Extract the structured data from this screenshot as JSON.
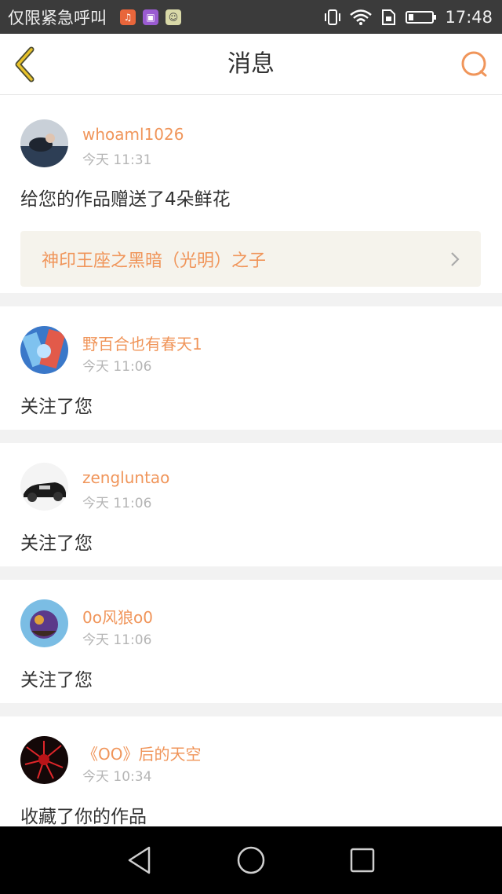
{
  "status_bar": {
    "carrier": "仅限紧急呼叫",
    "time": "17:48",
    "icons": [
      "music-app-icon",
      "gallery-app-icon",
      "chat-app-icon",
      "vibrate-icon",
      "wifi-icon",
      "sim-icon",
      "battery-icon"
    ]
  },
  "header": {
    "title": "消息",
    "accent_color": "#f0955a"
  },
  "messages": [
    {
      "username": "whoaml1026",
      "time": "今天 11:31",
      "action": "给您的作品赠送了4朵鲜花",
      "work_title": "神印王座之黑暗（光明）之子"
    },
    {
      "username": "野百合也有春天1",
      "time": "今天 11:06",
      "action": "关注了您"
    },
    {
      "username": "zengluntao",
      "time": "今天 11:06",
      "action": "关注了您"
    },
    {
      "username": "0o风狼o0",
      "time": "今天 11:06",
      "action": "关注了您"
    },
    {
      "username": "《OO》后的天空",
      "time": "今天 10:34",
      "action": "收藏了你的作品"
    }
  ],
  "system_nav": [
    "back-nav-icon",
    "home-nav-icon",
    "recents-nav-icon"
  ]
}
